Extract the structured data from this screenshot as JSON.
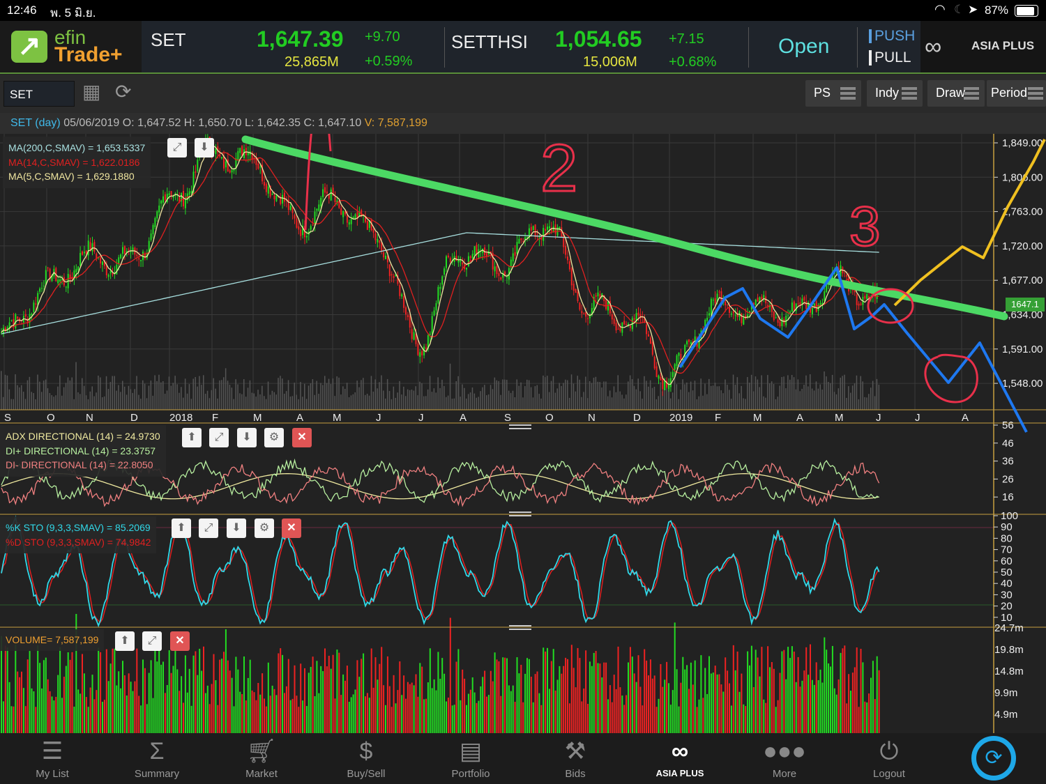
{
  "status_bar": {
    "time": "12:46",
    "date": "พ. 5 มิ.ย.",
    "battery": "87%",
    "battery_level": 0.87
  },
  "header": {
    "logo_line1": "efin",
    "logo_line2": "Trade+",
    "set": {
      "name": "SET",
      "value": "1,647.39",
      "change": "+9.70",
      "volume": "25,865M",
      "pct": "+0.59%"
    },
    "setthsi": {
      "name": "SETTHSI",
      "value": "1,054.65",
      "change": "+7.15",
      "volume": "15,006M",
      "pct": "+0.68%"
    },
    "market_status": "Open",
    "push": "PUSH",
    "pull": "PULL",
    "brand": "ASIA PLUS"
  },
  "toolbar": {
    "symbol": "SET",
    "buttons": [
      "PS",
      "Indy",
      "Draw",
      "Period"
    ]
  },
  "info": {
    "title": "SET (day)",
    "date": "05/06/2019",
    "o_label": "O:",
    "o": "1,647.52",
    "h_label": "H:",
    "h": "1,650.70",
    "l_label": "L:",
    "l": "1,642.35",
    "c_label": "C:",
    "c": "1,647.10",
    "v_label": "V:",
    "v": "7,587,199"
  },
  "main_legend": {
    "ma200": "MA(200,C,SMAV) = 1,653.5337",
    "ma14": "MA(14,C,SMAV) = 1,622.0186",
    "ma5": "MA(5,C,SMAV) = 1,629.1880"
  },
  "price_axis": [
    "1,849.00",
    "1,806.00",
    "1,763.00",
    "1,720.00",
    "1,677.00",
    "1,634.00",
    "1,591.00",
    "1,548.00"
  ],
  "last_price_tag": "1647.1",
  "time_axis": [
    "S",
    "O",
    "N",
    "D",
    "2018",
    "F",
    "M",
    "A",
    "M",
    "J",
    "J",
    "A",
    "S",
    "O",
    "N",
    "D",
    "2019",
    "F",
    "M",
    "A",
    "M",
    "J",
    "J",
    "A"
  ],
  "annotations": {
    "two": "2",
    "three": "3"
  },
  "adx_legend": {
    "adx": "ADX DIRECTIONAL (14) = 24.9730",
    "di_plus": "DI+ DIRECTIONAL (14) = 23.3757",
    "di_minus": "DI- DIRECTIONAL (14) = 22.8050"
  },
  "adx_axis": [
    "56",
    "46",
    "36",
    "26",
    "16"
  ],
  "sto_legend": {
    "k": "%K STO (9,3,3,SMAV) = 85.2069",
    "d": "%D STO (9,3,3,SMAV) = 74.9842"
  },
  "sto_axis": [
    "100",
    "90",
    "80",
    "70",
    "60",
    "50",
    "40",
    "30",
    "20",
    "10"
  ],
  "volume_legend": "VOLUME= 7,587,199",
  "volume_axis": [
    "24.7m",
    "19.8m",
    "14.8m",
    "9.9m",
    "4.9m"
  ],
  "nav": [
    {
      "label": "My List",
      "icon": "list-icon"
    },
    {
      "label": "Summary",
      "icon": "sigma-icon"
    },
    {
      "label": "Market",
      "icon": "cart-icon"
    },
    {
      "label": "Buy/Sell",
      "icon": "dollar-exchange-icon"
    },
    {
      "label": "Portfolio",
      "icon": "portfolio-icon"
    },
    {
      "label": "Bids",
      "icon": "gavel-icon"
    },
    {
      "label": "ASIA PLUS",
      "icon": "asia-plus-logo"
    },
    {
      "label": "More",
      "icon": "more-dots-icon"
    },
    {
      "label": "Logout",
      "icon": "power-icon"
    }
  ],
  "colors": {
    "up": "#22dd22",
    "down": "#ee2222",
    "ma200": "#a8e0e0",
    "ma14": "#e02020",
    "ma5": "#f0e6a0",
    "trend_annotation": "#4cd964",
    "accent": "#5ee0e0",
    "axis": "#c8a040"
  },
  "chart_data": {
    "type": "candlestick",
    "symbol": "SET",
    "period": "day",
    "ylim": [
      1530,
      1860
    ],
    "approx_close_by_month": [
      {
        "m": "S",
        "close": 1609
      },
      {
        "m": "O",
        "close": 1670
      },
      {
        "m": "N",
        "close": 1705
      },
      {
        "m": "D",
        "close": 1701
      },
      {
        "m": "2018",
        "close": 1775
      },
      {
        "m": "F",
        "close": 1836
      },
      {
        "m": "M",
        "close": 1827
      },
      {
        "m": "A",
        "close": 1749
      },
      {
        "m": "M",
        "close": 1775
      },
      {
        "m": "J",
        "close": 1731
      },
      {
        "m": "J",
        "close": 1600
      },
      {
        "m": "A",
        "close": 1714
      },
      {
        "m": "S",
        "close": 1696
      },
      {
        "m": "O",
        "close": 1749
      },
      {
        "m": "N",
        "close": 1644
      },
      {
        "m": "D",
        "close": 1627
      },
      {
        "m": "2019",
        "close": 1557
      },
      {
        "m": "F",
        "close": 1644
      },
      {
        "m": "M",
        "close": 1644
      },
      {
        "m": "A",
        "close": 1635
      },
      {
        "m": "M",
        "close": 1679
      },
      {
        "m": "J",
        "close": 1647
      }
    ]
  }
}
